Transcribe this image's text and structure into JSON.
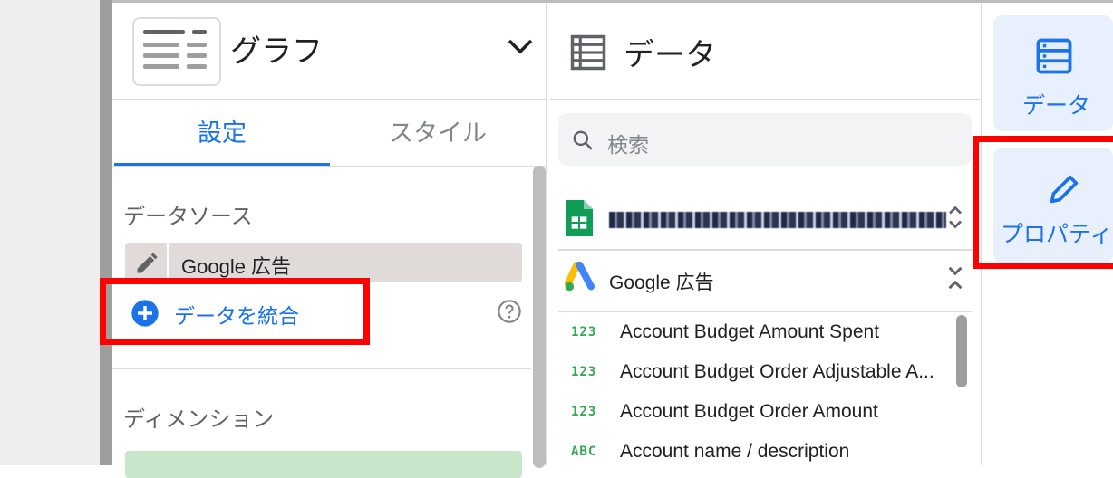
{
  "properties_panel": {
    "chart_type": "グラフ",
    "tabs": [
      "設定",
      "スタイル"
    ],
    "data_source_label": "データソース",
    "data_source_name": "Google 広告",
    "blend_label": "データを統合",
    "dimension_label": "ディメンション"
  },
  "data_panel": {
    "title": "データ",
    "search_placeholder": "検索",
    "sources": [
      {
        "name": "Google 広告"
      }
    ],
    "fields": [
      {
        "type": "123",
        "name": "Account Budget Amount Spent"
      },
      {
        "type": "123",
        "name": "Account Budget Order Adjustable A..."
      },
      {
        "type": "123",
        "name": "Account Budget Order Amount"
      },
      {
        "type": "ABC",
        "name": "Account name / description"
      }
    ]
  },
  "right_rail": {
    "data_label": "データ",
    "properties_label": "プロパティ"
  },
  "colors": {
    "accent": "#1a73e8",
    "highlight": "#ff0000"
  }
}
